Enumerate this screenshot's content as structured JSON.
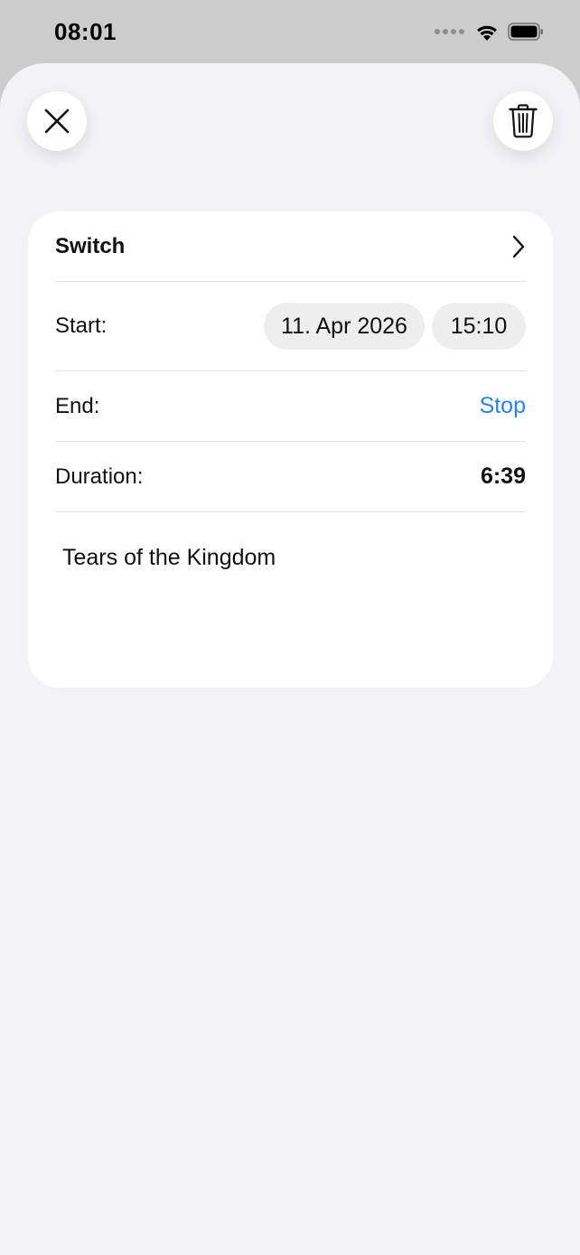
{
  "status_bar": {
    "time": "08:01",
    "icons": [
      "signal-dots-icon",
      "wifi-icon",
      "battery-icon"
    ]
  },
  "toolbar": {
    "close_icon": "close-icon",
    "delete_icon": "trash-icon"
  },
  "entry": {
    "title": "Switch",
    "start_label": "Start:",
    "start_date": "11. Apr 2026",
    "start_time": "15:10",
    "end_label": "End:",
    "stop_label": "Stop",
    "duration_label": "Duration:",
    "duration_value": "6:39",
    "notes": "Tears of the Kingdom"
  },
  "colors": {
    "accent": "#2a84e8",
    "sheet_background": "#f2f2f7",
    "card_background": "#ffffff"
  }
}
